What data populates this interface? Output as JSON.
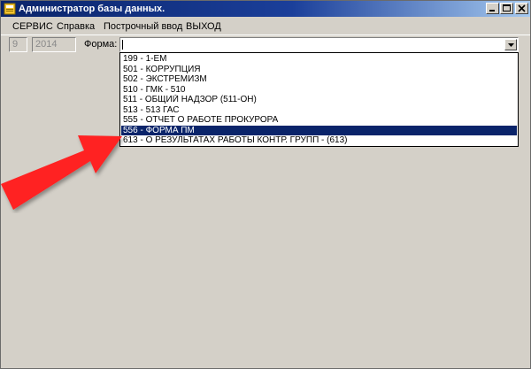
{
  "window": {
    "title": "Администратор базы данных."
  },
  "menu": {
    "items": [
      "СЕРВИС",
      "Справка",
      "Построчный ввод",
      "ВЫХОД"
    ]
  },
  "form": {
    "field1_value": "9",
    "field2_value": "2014",
    "forma_label": "Форма:",
    "combo_value": ""
  },
  "dropdown": {
    "options": [
      "199 - 1-ЕМ",
      "501 - КОРРУПЦИЯ",
      "502 - ЭКСТРЕМИЗМ",
      "510 - ГМК - 510",
      "511 - ОБЩИЙ НАДЗОР (511-ОН)",
      "513 - 513 ГАС",
      "555 - ОТЧЕТ О РАБОТЕ ПРОКУРОРА",
      "556 - ФОРМА ПМ",
      "613 - О РЕЗУЛЬТАТАХ РАБОТЫ КОНТР. ГРУПП - (613)"
    ],
    "selected_index": 7
  },
  "colors": {
    "title_bar": "#0a246a",
    "selection": "#0a246a",
    "arrow": "#ff2020",
    "window_bg": "#d4d0c8"
  },
  "icons": {
    "title": "database-app-icon",
    "minimize": "minimize-icon",
    "maximize": "maximize-icon",
    "close": "close-icon",
    "dropdown": "chevron-down-icon",
    "annotation": "red-arrow-icon"
  }
}
